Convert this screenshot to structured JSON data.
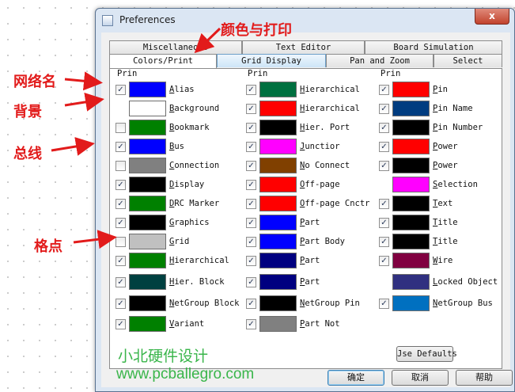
{
  "window": {
    "title": "Preferences",
    "close_glyph": "x"
  },
  "tabs_back": [
    "Miscellaneous",
    "Text Editor",
    "Board Simulation"
  ],
  "tabs_front": [
    "Colors/Print",
    "Grid Display",
    "Pan and Zoom",
    "Select"
  ],
  "columns": [
    {
      "header": "Prin",
      "items": [
        {
          "label": "Alias",
          "color": "#0000ff",
          "checked": true
        },
        {
          "label": "Background",
          "color": "#ffffff",
          "checked": null
        },
        {
          "label": "Bookmark",
          "color": "#008000",
          "checked": false
        },
        {
          "label": "Bus",
          "color": "#0000ff",
          "checked": true
        },
        {
          "label": "Connection",
          "color": "#808080",
          "checked": false
        },
        {
          "label": "Display",
          "color": "#000000",
          "checked": true
        },
        {
          "label": "DRC Marker",
          "color": "#008000",
          "checked": true
        },
        {
          "label": "Graphics",
          "color": "#000000",
          "checked": true
        },
        {
          "label": "Grid",
          "color": "#c0c0c0",
          "checked": false
        },
        {
          "label": "Hierarchical",
          "color": "#008000",
          "checked": true
        },
        {
          "label": "Hier. Block",
          "color": "#004040",
          "checked": true
        },
        {
          "label": "NetGroup Block",
          "color": "#000000",
          "checked": true
        },
        {
          "label": "Variant",
          "color": "#008000",
          "checked": true
        }
      ]
    },
    {
      "header": "Prin",
      "items": [
        {
          "label": "Hierarchical",
          "color": "#007040",
          "checked": true
        },
        {
          "label": "Hierarchical",
          "color": "#ff0000",
          "checked": true
        },
        {
          "label": "Hier. Port",
          "color": "#000000",
          "checked": true
        },
        {
          "label": "Junctior",
          "color": "#ff00ff",
          "checked": true
        },
        {
          "label": "No Connect",
          "color": "#804000",
          "checked": true
        },
        {
          "label": "Off-page",
          "color": "#ff0000",
          "checked": true
        },
        {
          "label": "Off-page Cnctr",
          "color": "#ff0000",
          "checked": true
        },
        {
          "label": "Part",
          "color": "#0000ff",
          "checked": true
        },
        {
          "label": "Part Body",
          "color": "#0000ff",
          "checked": true
        },
        {
          "label": "Part",
          "color": "#000080",
          "checked": true
        },
        {
          "label": "Part",
          "color": "#000080",
          "checked": true
        },
        {
          "label": "NetGroup Pin",
          "color": "#000000",
          "checked": true
        },
        {
          "label": "Part Not",
          "color": "#808080",
          "checked": true
        }
      ]
    },
    {
      "header": "Prin",
      "items": [
        {
          "label": "Pin",
          "color": "#ff0000",
          "checked": true
        },
        {
          "label": "Pin Name",
          "color": "#003c80",
          "checked": true
        },
        {
          "label": "Pin Number",
          "color": "#000000",
          "checked": true
        },
        {
          "label": "Power",
          "color": "#ff0000",
          "checked": true
        },
        {
          "label": "Power",
          "color": "#000000",
          "checked": true
        },
        {
          "label": "Selection",
          "color": "#ff00ff",
          "checked": null
        },
        {
          "label": "Text",
          "color": "#000000",
          "checked": true
        },
        {
          "label": "Title",
          "color": "#000000",
          "checked": true
        },
        {
          "label": "Title",
          "color": "#000000",
          "checked": true
        },
        {
          "label": "Wire",
          "color": "#800040",
          "checked": true
        },
        {
          "label": "Locked Object",
          "color": "#303080",
          "checked": null
        },
        {
          "label": "NetGroup Bus",
          "color": "#0070c0",
          "checked": true
        }
      ]
    }
  ],
  "buttons": {
    "use_defaults": "Jse Defaults",
    "ok": "确定",
    "cancel": "取消",
    "help": "帮助"
  },
  "annotations": {
    "tabs_note": "颜色与打印",
    "net_name": "网络名",
    "background": "背景",
    "bus": "总线",
    "grid_dot": "格点",
    "color": "#e21b1b"
  },
  "watermark": {
    "brand": "小北硬件设计",
    "url": "www.pcballegro.com",
    "color": "#39b54a"
  }
}
